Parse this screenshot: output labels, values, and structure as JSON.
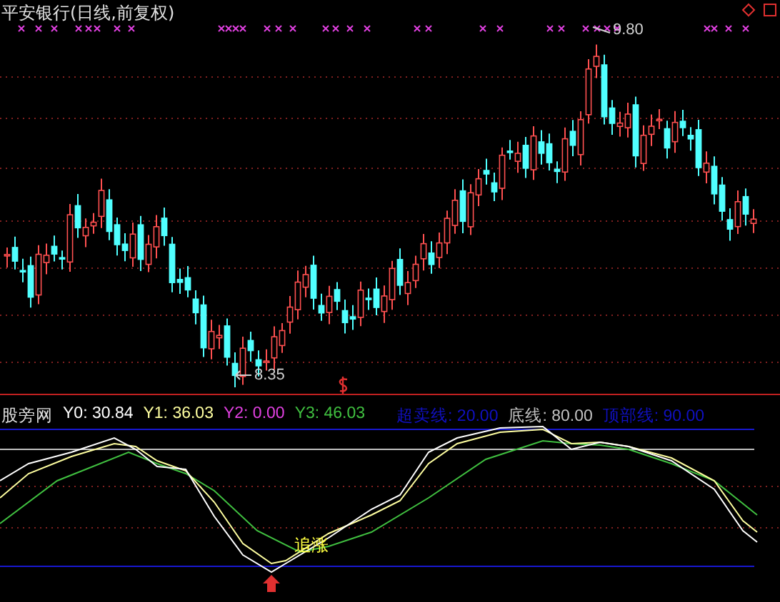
{
  "title": "平安银行(日线,前复权)",
  "price_labels": [
    {
      "kind": "high",
      "text": "9.80"
    },
    {
      "kind": "low",
      "text": "8.35"
    }
  ],
  "indicator": {
    "name": "股旁网",
    "values": [
      {
        "text": "Y0: 30.84",
        "color": "#ffffff"
      },
      {
        "text": "Y1: 36.03",
        "color": "#ffffa0"
      },
      {
        "text": "Y2: 0.00",
        "color": "#e040e0"
      },
      {
        "text": "Y3: 46.03",
        "color": "#40c040"
      }
    ],
    "lines": [
      {
        "text": "超卖线: 20.00",
        "color": "#1010c0"
      },
      {
        "text": "底线: 80.00",
        "color": "#c0c0c0"
      },
      {
        "text": "顶部线: 90.00",
        "color": "#1010c0"
      }
    ],
    "signal": "追涨"
  }
}
